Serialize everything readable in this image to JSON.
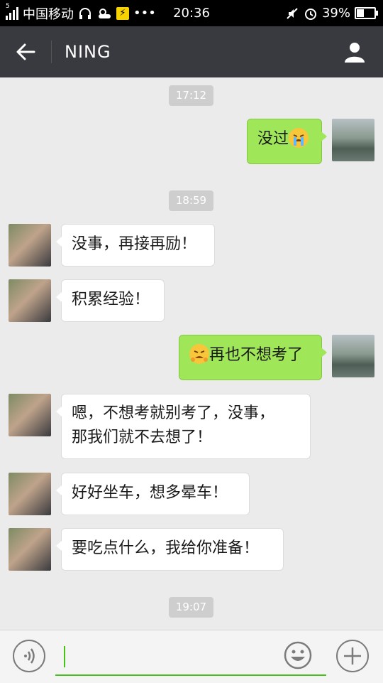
{
  "status_bar": {
    "carrier": "中国移动",
    "network": "5",
    "time": "20:36",
    "more": "•••",
    "battery": "39%",
    "battery_level": 0.39
  },
  "header": {
    "title": "NING",
    "back_icon": "arrow-left-icon",
    "profile_icon": "person-icon"
  },
  "colors": {
    "title_bar": "#393a3f",
    "outgoing_bubble": "#9fe658",
    "incoming_bubble": "#ffffff",
    "accent": "#45c01a",
    "background": "#ebebeb"
  },
  "messages": [
    {
      "kind": "timestamp",
      "text": "17:12"
    },
    {
      "kind": "out",
      "text": "没过",
      "emoji": "crying-face-emoji"
    },
    {
      "kind": "timestamp",
      "text": "18:59"
    },
    {
      "kind": "in",
      "text": "没事，再接再励！"
    },
    {
      "kind": "in",
      "text": "积累经验！"
    },
    {
      "kind": "out",
      "text": "再也不想考了",
      "emoji": "weary-face-emoji"
    },
    {
      "kind": "in",
      "line1": "嗯，不想考就别考了，没事，",
      "line2": "那我们就不去想了！"
    },
    {
      "kind": "in",
      "text": "好好坐车，想多晕车！"
    },
    {
      "kind": "in",
      "text": "要吃点什么，我给你准备！"
    },
    {
      "kind": "timestamp",
      "text": "19:07"
    }
  ],
  "input_bar": {
    "value": "",
    "voice_icon": "voice-icon",
    "emoji_icon": "smiley-icon",
    "plus_icon": "plus-icon"
  }
}
